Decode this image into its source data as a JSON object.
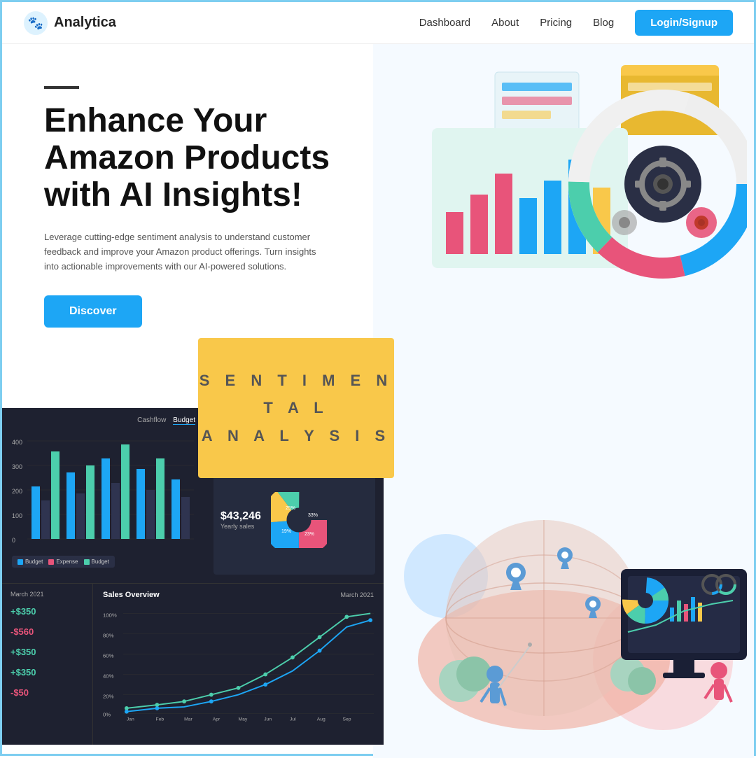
{
  "navbar": {
    "brand": "Analytica",
    "links": {
      "dashboard": "Dashboard",
      "about": "About",
      "pricing": "Pricing",
      "blog": "Blog",
      "login": "Login/Signup"
    }
  },
  "hero": {
    "title": "Enhance Your Amazon Products with AI Insights!",
    "description": "Leverage cutting-edge sentiment analysis to understand customer feedback and improve your Amazon product offerings. Turn insights into actionable improvements with our AI-powered solutions.",
    "cta": "Discover",
    "sentiment_line1": "S E N T I M E N T A L",
    "sentiment_line2": "A N A L Y S I S"
  },
  "dashboard": {
    "panel_header1": "Cashflow",
    "panel_header2": "Budget",
    "legend": [
      "Budget",
      "Expense",
      "Budget"
    ],
    "legend_colors": [
      "#1da6f5",
      "#e8547a",
      "#4cceac"
    ],
    "sales_amount": "$43,246",
    "sales_label": "Yearly sales",
    "metrics": [
      {
        "label": "March 2021",
        "value": "+$350",
        "color": "green"
      },
      {
        "label": "",
        "value": "-$560",
        "color": "pink"
      },
      {
        "label": "",
        "value": "+$350",
        "color": "green"
      },
      {
        "label": "",
        "value": "+$350",
        "color": "green"
      },
      {
        "label": "",
        "value": "-$50",
        "color": "pink"
      }
    ],
    "overview_title": "Sales Overview",
    "overview_date": "March 2021",
    "panel_date": "March 2021"
  },
  "colors": {
    "primary": "#1da6f5",
    "background": "#f5faff",
    "dark_panel": "#1e2130",
    "accent_yellow": "#f9c84a",
    "bar_blue": "#1da6f5",
    "bar_teal": "#4cceac",
    "bar_dark": "#2f3450"
  }
}
